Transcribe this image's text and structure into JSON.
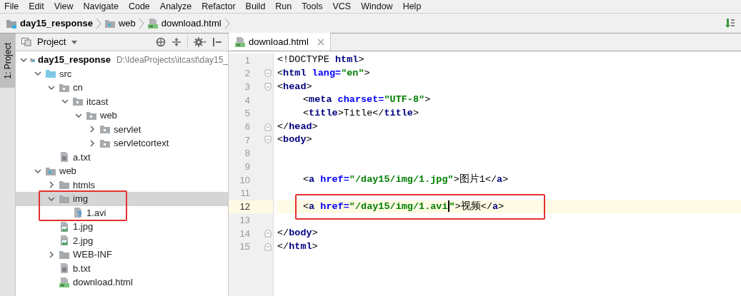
{
  "menu": [
    "File",
    "Edit",
    "View",
    "Navigate",
    "Code",
    "Analyze",
    "Refactor",
    "Build",
    "Run",
    "Tools",
    "VCS",
    "Window",
    "Help"
  ],
  "breadcrumb": [
    {
      "label": "day15_response",
      "kind": "module"
    },
    {
      "label": "web",
      "kind": "web-folder"
    },
    {
      "label": "download.html",
      "kind": "html-file"
    }
  ],
  "side_stripe": {
    "label": "1: Project",
    "selected": true
  },
  "project_panel": {
    "title": "Project"
  },
  "tree": [
    {
      "label": "day15_response",
      "kind": "module",
      "path": "D:\\IdeaProjects\\itcast\\day15_",
      "expanded": true,
      "selected": false,
      "boxed": false,
      "children": [
        {
          "label": "src",
          "kind": "source-folder",
          "expanded": true,
          "selected": false,
          "boxed": false,
          "children": [
            {
              "label": "cn",
              "kind": "package",
              "expanded": true,
              "selected": false,
              "boxed": false,
              "children": [
                {
                  "label": "itcast",
                  "kind": "package",
                  "expanded": true,
                  "selected": false,
                  "boxed": false,
                  "children": [
                    {
                      "label": "web",
                      "kind": "package",
                      "expanded": true,
                      "selected": false,
                      "boxed": false,
                      "children": [
                        {
                          "label": "servlet",
                          "kind": "package",
                          "expanded": false,
                          "selected": false,
                          "boxed": false
                        },
                        {
                          "label": "servletcortext",
                          "kind": "package",
                          "expanded": false,
                          "selected": false,
                          "boxed": false
                        }
                      ]
                    }
                  ]
                }
              ]
            },
            {
              "label": "a.txt",
              "kind": "text-file",
              "selected": false,
              "boxed": false
            }
          ]
        },
        {
          "label": "web",
          "kind": "web-folder",
          "expanded": true,
          "selected": false,
          "boxed": false,
          "children": [
            {
              "label": "htmls",
              "kind": "folder",
              "expanded": false,
              "selected": false,
              "boxed": false
            },
            {
              "label": "img",
              "kind": "folder",
              "expanded": true,
              "selected": true,
              "boxed": true,
              "children": [
                {
                  "label": "1.avi",
                  "kind": "unknown-file",
                  "selected": false,
                  "boxed": true
                }
              ]
            },
            {
              "label": "1.jpg",
              "kind": "image-file",
              "selected": false,
              "boxed": false
            },
            {
              "label": "2.jpg",
              "kind": "image-file",
              "selected": false,
              "boxed": false
            },
            {
              "label": "WEB-INF",
              "kind": "folder",
              "expanded": false,
              "selected": false,
              "boxed": false
            },
            {
              "label": "b.txt",
              "kind": "text-file",
              "selected": false,
              "boxed": false
            },
            {
              "label": "download.html",
              "kind": "html-file",
              "selected": false,
              "boxed": false
            }
          ]
        }
      ]
    }
  ],
  "editor_tabs": [
    {
      "label": "download.html",
      "selected": true
    }
  ],
  "code": [
    {
      "number": "1",
      "tokens": [
        {
          "kind": "text",
          "text": "<!DOCTYPE"
        },
        {
          "kind": "tag",
          "text": " html"
        },
        {
          "kind": "text",
          "text": ">"
        }
      ]
    },
    {
      "number": "2",
      "fold_start": true,
      "tokens": [
        {
          "kind": "punct",
          "text": "<"
        },
        {
          "kind": "tag",
          "text": "html"
        },
        {
          "kind": "attr",
          "text": " lang="
        },
        {
          "kind": "value",
          "text": "\"en\""
        },
        {
          "kind": "punct",
          "text": ">"
        }
      ]
    },
    {
      "number": "3",
      "fold_start": true,
      "tokens": [
        {
          "kind": "punct",
          "text": "<"
        },
        {
          "kind": "tag",
          "text": "head"
        },
        {
          "kind": "punct",
          "text": ">"
        }
      ]
    },
    {
      "number": "4",
      "indented": true,
      "tokens": [
        {
          "kind": "punct",
          "text": "<"
        },
        {
          "kind": "tag",
          "text": "meta"
        },
        {
          "kind": "attr",
          "text": " charset="
        },
        {
          "kind": "value",
          "text": "\"UTF-8\""
        },
        {
          "kind": "punct",
          "text": ">"
        }
      ]
    },
    {
      "number": "5",
      "indented": true,
      "tokens": [
        {
          "kind": "punct",
          "text": "<"
        },
        {
          "kind": "tag",
          "text": "title"
        },
        {
          "kind": "punct",
          "text": ">"
        },
        {
          "kind": "text",
          "text": "Title"
        },
        {
          "kind": "punct",
          "text": "</"
        },
        {
          "kind": "tag",
          "text": "title"
        },
        {
          "kind": "punct",
          "text": ">"
        }
      ]
    },
    {
      "number": "6",
      "fold_end": true,
      "tokens": [
        {
          "kind": "punct",
          "text": "</"
        },
        {
          "kind": "tag",
          "text": "head"
        },
        {
          "kind": "punct",
          "text": ">"
        }
      ]
    },
    {
      "number": "7",
      "fold_start": true,
      "tokens": [
        {
          "kind": "punct",
          "text": "<"
        },
        {
          "kind": "tag",
          "text": "body"
        },
        {
          "kind": "punct",
          "text": ">"
        }
      ]
    },
    {
      "number": "8"
    },
    {
      "number": "9"
    },
    {
      "number": "10",
      "indented": true,
      "tokens": [
        {
          "kind": "punct",
          "text": "<"
        },
        {
          "kind": "tag",
          "text": "a"
        },
        {
          "kind": "attr",
          "text": " href="
        },
        {
          "kind": "value",
          "text": "\"/day15/img/1.jpg\""
        },
        {
          "kind": "punct",
          "text": ">"
        },
        {
          "kind": "text",
          "text": "图片1"
        },
        {
          "kind": "punct",
          "text": "</"
        },
        {
          "kind": "tag",
          "text": "a"
        },
        {
          "kind": "punct",
          "text": ">"
        }
      ]
    },
    {
      "number": "11"
    },
    {
      "number": "12",
      "indented": true,
      "current": true,
      "boxed": true,
      "tokens": [
        {
          "kind": "punct",
          "text": "<"
        },
        {
          "kind": "tag",
          "text": "a"
        },
        {
          "kind": "attr",
          "text": " href="
        },
        {
          "kind": "value",
          "text": "\"/day15/img/1.avi"
        },
        {
          "kind": "value",
          "text": "\"",
          "caret": true
        },
        {
          "kind": "punct",
          "text": ">"
        },
        {
          "kind": "text",
          "text": "视频"
        },
        {
          "kind": "punct",
          "text": "</"
        },
        {
          "kind": "tag",
          "text": "a"
        },
        {
          "kind": "punct",
          "text": ">"
        }
      ]
    },
    {
      "number": "13"
    },
    {
      "number": "14",
      "fold_end": true,
      "tokens": [
        {
          "kind": "punct",
          "text": "</"
        },
        {
          "kind": "tag",
          "text": "body"
        },
        {
          "kind": "punct",
          "text": ">"
        }
      ]
    },
    {
      "number": "15",
      "fold_end": true,
      "tokens": [
        {
          "kind": "punct",
          "text": "</"
        },
        {
          "kind": "tag",
          "text": "html"
        },
        {
          "kind": "punct",
          "text": ">"
        }
      ]
    }
  ]
}
